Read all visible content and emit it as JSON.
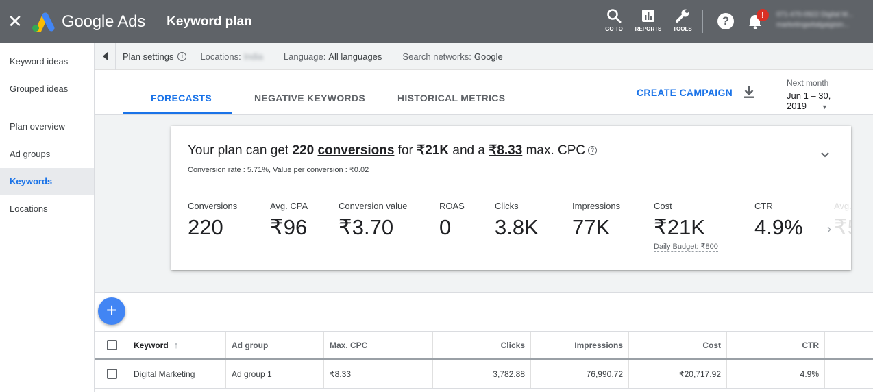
{
  "topbar": {
    "brand": "Google Ads",
    "page_title": "Keyword plan",
    "goto_label": "GO TO",
    "reports_label": "REPORTS",
    "tools_label": "TOOLS",
    "help_glyph": "?",
    "notification_badge": "!",
    "account_info": "071-470-0922 Digital M... marketingwitalgaigisin..."
  },
  "sidebar": {
    "items": [
      {
        "label": "Keyword ideas"
      },
      {
        "label": "Grouped ideas"
      },
      {
        "label": "Plan overview"
      },
      {
        "label": "Ad groups"
      },
      {
        "label": "Keywords"
      },
      {
        "label": "Locations"
      }
    ],
    "active": "Keywords"
  },
  "settings_bar": {
    "plan_settings": "Plan settings",
    "locations_key": "Locations:",
    "locations_value": "India",
    "language_key": "Language:",
    "language_value": "All languages",
    "networks_key": "Search networks:",
    "networks_value": "Google"
  },
  "tabs": {
    "forecasts": "FORECASTS",
    "negative_keywords": "NEGATIVE KEYWORDS",
    "historical_metrics": "HISTORICAL METRICS",
    "active": "FORECASTS"
  },
  "actions": {
    "create_campaign": "CREATE CAMPAIGN"
  },
  "date_range": {
    "label": "Next month",
    "value": "Jun 1 – 30, 2019"
  },
  "summary": {
    "prefix": "Your plan can get",
    "conversions_count": "220",
    "conversions_word": "conversions",
    "for_word": "for",
    "cost": "₹21K",
    "and_a": "and a",
    "max_cpc": "₹8.33",
    "max_cpc_suffix": "max. CPC",
    "subline": "Conversion rate : 5.71%, Value per conversion : ₹0.02"
  },
  "metrics": [
    {
      "label": "Conversions",
      "value": "220"
    },
    {
      "label": "Avg. CPA",
      "value": "₹96"
    },
    {
      "label": "Conversion value",
      "value": "₹3.70"
    },
    {
      "label": "ROAS",
      "value": "0"
    },
    {
      "label": "Clicks",
      "value": "3.8K"
    },
    {
      "label": "Impressions",
      "value": "77K"
    },
    {
      "label": "Cost",
      "value": "₹21K",
      "footnote": "Daily Budget: ₹800"
    },
    {
      "label": "CTR",
      "value": "4.9%"
    },
    {
      "label": "Avg.",
      "value": "₹5"
    }
  ],
  "table": {
    "columns": [
      "Keyword",
      "Ad group",
      "Max. CPC",
      "Clicks",
      "Impressions",
      "Cost",
      "CTR"
    ],
    "rows": [
      {
        "keyword": "Digital Marketing",
        "ad_group": "Ad group 1",
        "max_cpc": "₹8.33",
        "clicks": "3,782.88",
        "impressions": "76,990.72",
        "cost": "₹20,717.92",
        "ctr": "4.9%"
      }
    ]
  },
  "colors": {
    "topbar": "#5f6368",
    "accent": "#1a73e8",
    "fab": "#4285f4",
    "badge": "#d93025"
  }
}
